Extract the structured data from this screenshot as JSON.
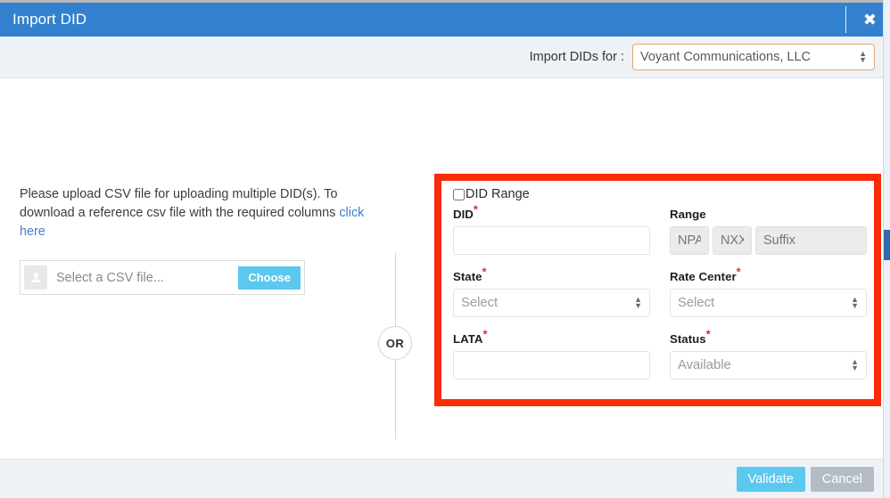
{
  "header": {
    "title": "Import DID",
    "close_label": "✖",
    "close_icon": "close-icon",
    "bg_color": "#3381ce"
  },
  "subheader": {
    "label": "Import DIDs for :",
    "account_value": "Voyant Communications, LLC",
    "account_options": [
      "Voyant Communications, LLC"
    ],
    "border_color": "#e0a96d"
  },
  "left_panel": {
    "description_part1": "Please upload CSV file for uploading multiple DID(s). To download a reference csv file with the required columns ",
    "link_text": "click here",
    "file_placeholder": "Select a CSV file...",
    "choose_label": "Choose",
    "upload_icon": "upload-icon",
    "choose_color": "#5bc8ef"
  },
  "divider": {
    "or_label": "OR"
  },
  "right_form": {
    "range_checkbox_label": "DID Range",
    "range_checkbox_checked": false,
    "fields": {
      "did": {
        "label": "DID",
        "required": true,
        "value": "",
        "placeholder": ""
      },
      "range": {
        "label": "Range",
        "required": false,
        "npa_placeholder": "NPA",
        "nxx_placeholder": "NXX",
        "suffix_placeholder": "Suffix",
        "npa_value": "",
        "nxx_value": "",
        "suffix_value": "",
        "disabled": true
      },
      "state": {
        "label": "State",
        "required": true,
        "value": "Select",
        "options": [
          "Select"
        ]
      },
      "rate_center": {
        "label": "Rate Center",
        "required": true,
        "value": "Select",
        "options": [
          "Select"
        ]
      },
      "lata": {
        "label": "LATA",
        "required": true,
        "value": "",
        "placeholder": ""
      },
      "status": {
        "label": "Status",
        "required": true,
        "value": "Available",
        "options": [
          "Available"
        ]
      }
    },
    "required_marker": "*",
    "highlight_color": "#fa2b06"
  },
  "footer": {
    "validate_label": "Validate",
    "cancel_label": "Cancel",
    "validate_color": "#5bc8ef",
    "cancel_color": "#b3bcc4"
  }
}
